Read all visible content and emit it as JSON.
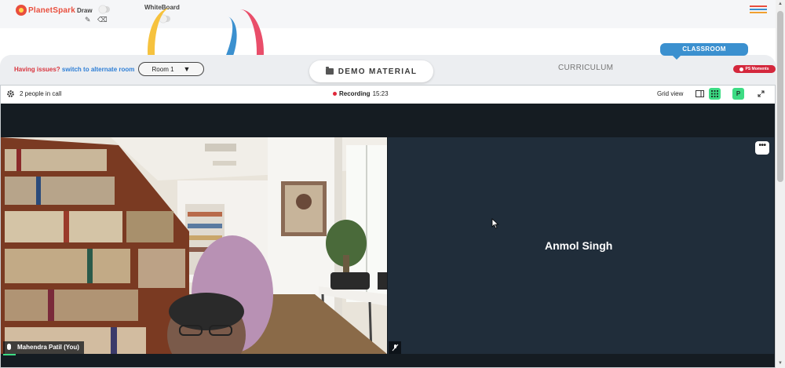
{
  "toolbar": {
    "logo_text": "PlanetSpark",
    "draw_label": "Draw",
    "whiteboard_label": "WhiteBoard"
  },
  "nav": {
    "issues_text": "Having issues?",
    "switch_link": "switch to alternate room",
    "room_selected": "Room 1",
    "demo_material": "DEMO MATERIAL",
    "curriculum": "CURRICULUM",
    "classroom": "CLASSROOM",
    "ps_moments": "PS Moments"
  },
  "call": {
    "people_count": "2 people in call",
    "recording_label": "Recording",
    "recording_time": "15:23",
    "grid_view_label": "Grid view",
    "avatar_letter": "P",
    "remote_name": "Anmol Singh",
    "local_name": "Mahendra Patil (You)"
  },
  "colors": {
    "brand_red": "#e94e3d",
    "link_blue": "#2f7fd6",
    "classroom_blue": "#3b90cf",
    "recording_red": "#e0283a",
    "active_green": "#3ddc84",
    "tile_bg": "#202d3a"
  },
  "icons": {
    "draw_tool": "pencil-icon",
    "erase_tool": "eraser-icon",
    "menu": "hamburger-icon",
    "settings": "gear-icon",
    "folder": "folder-icon",
    "fullscreen": "expand-icon"
  }
}
